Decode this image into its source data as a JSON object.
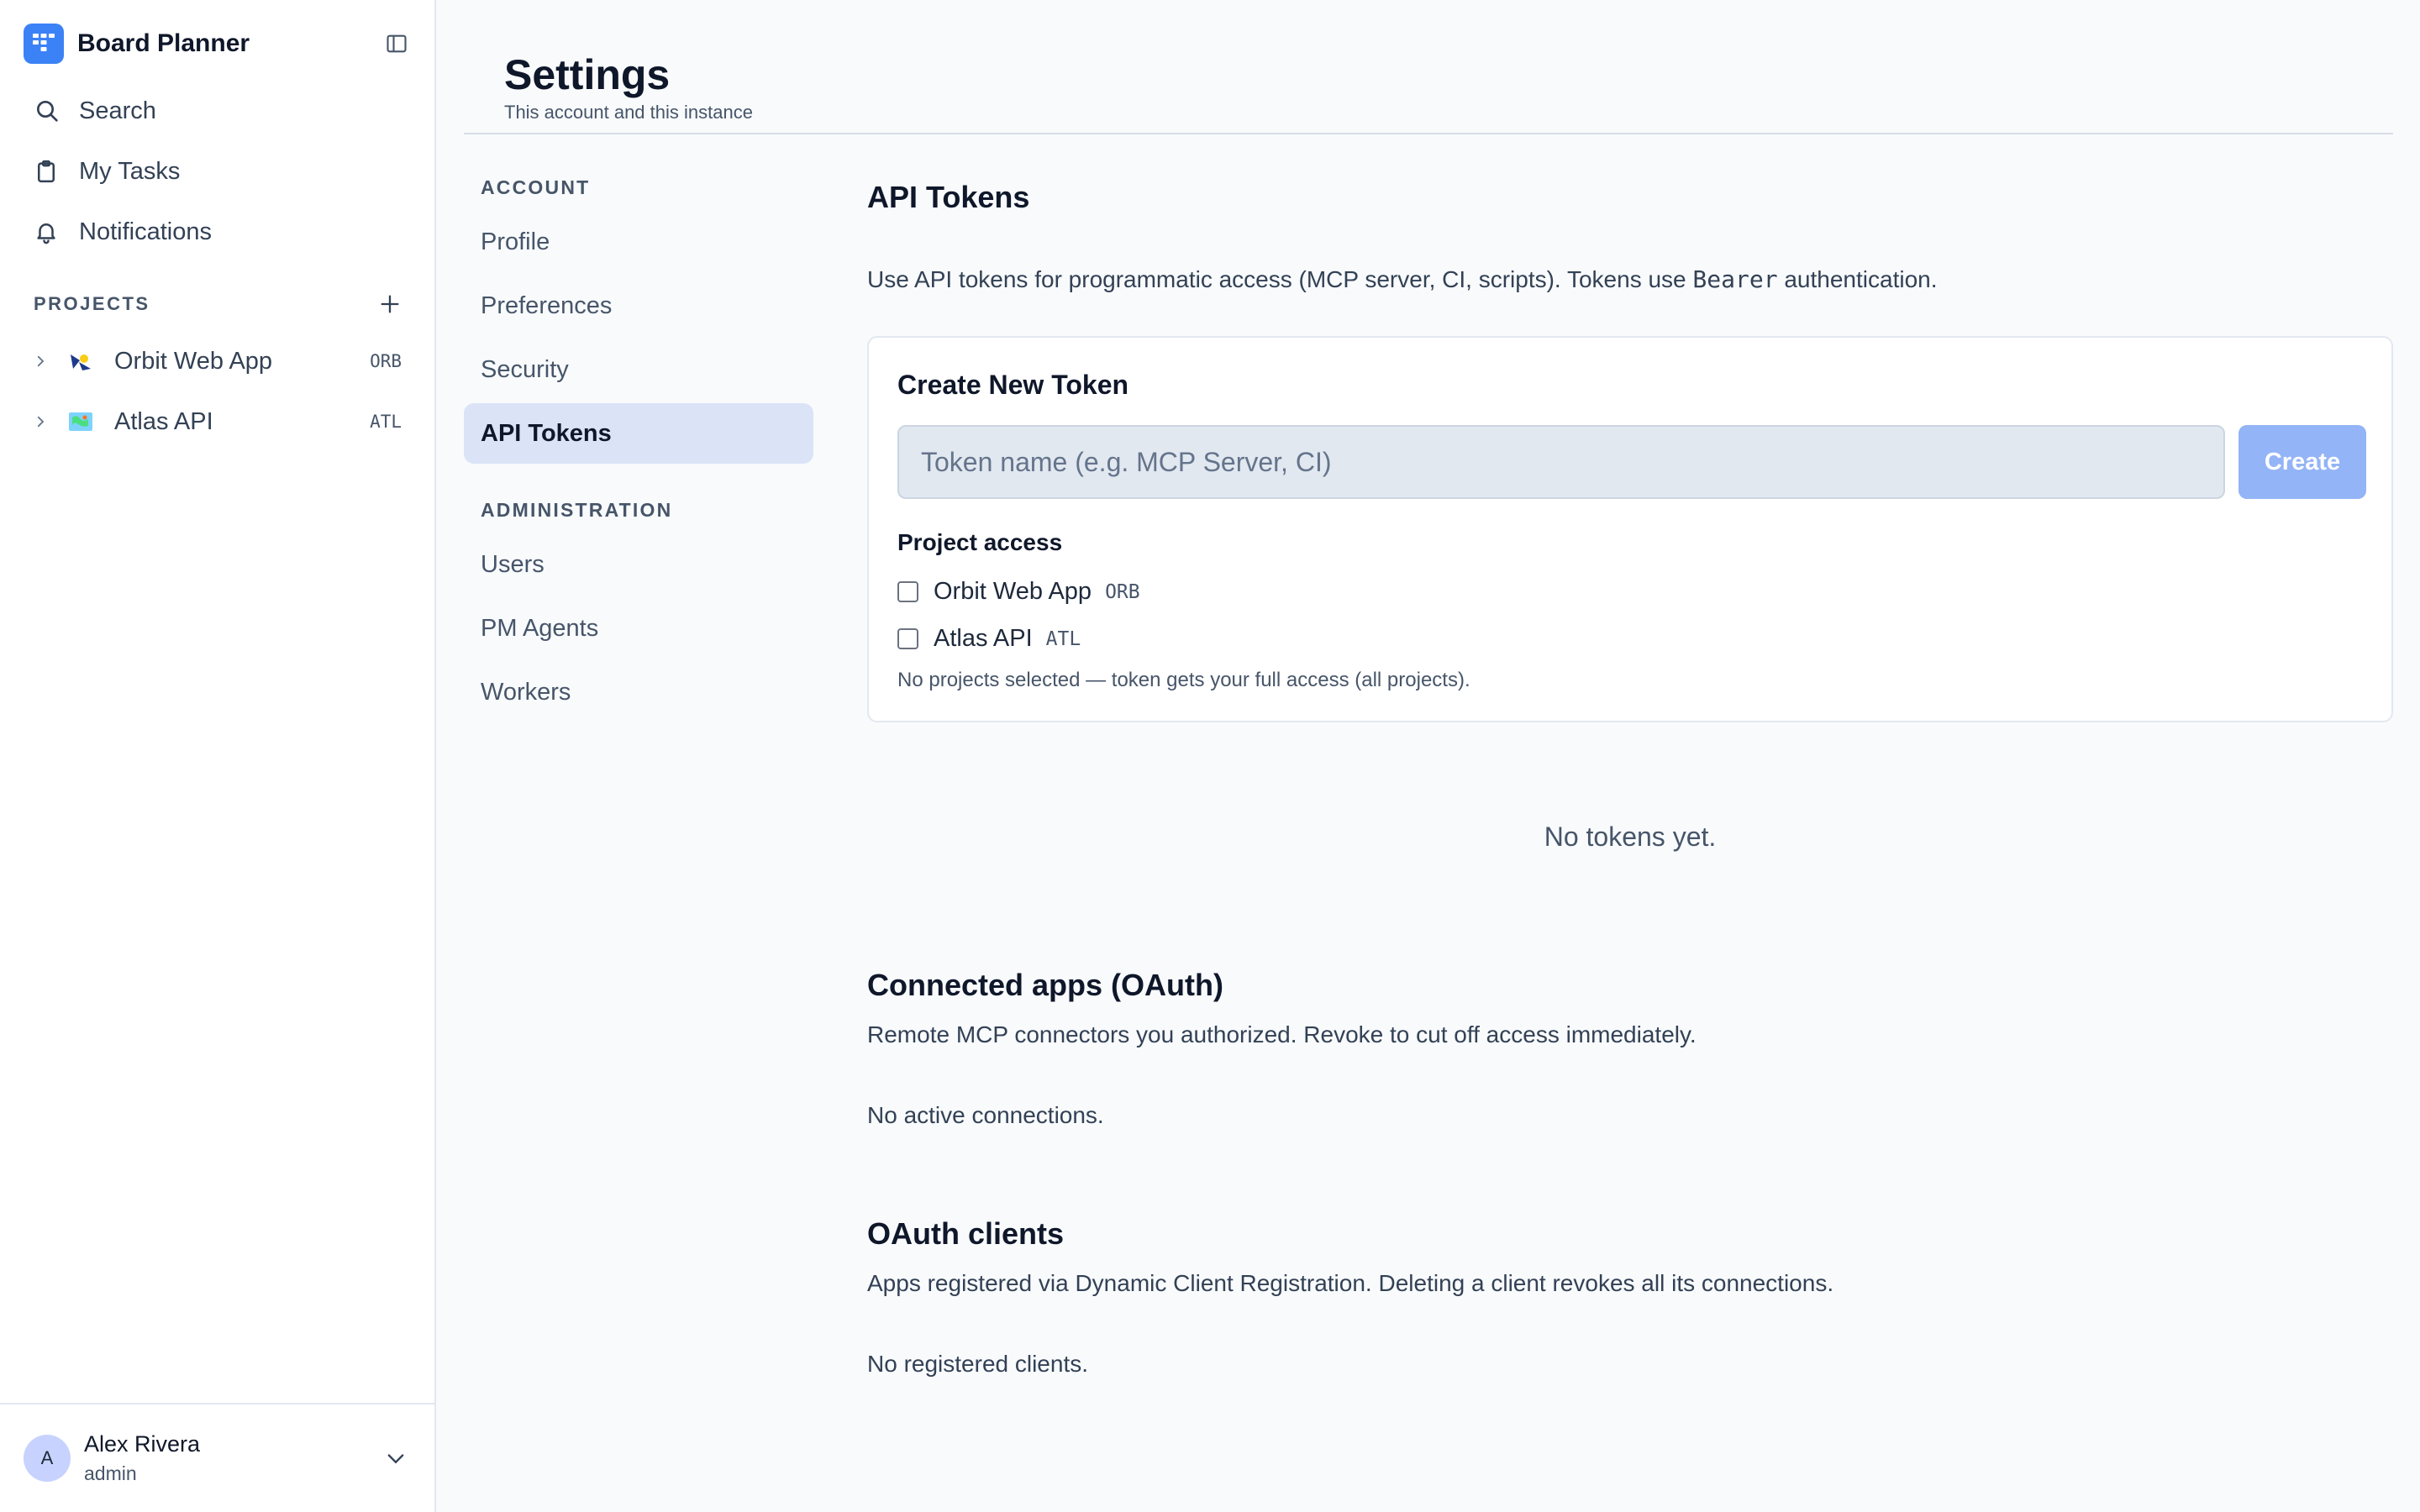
{
  "app": {
    "name": "Board Planner"
  },
  "sidebar": {
    "nav": [
      {
        "label": "Search",
        "icon": "search-icon"
      },
      {
        "label": "My Tasks",
        "icon": "clipboard-icon"
      },
      {
        "label": "Notifications",
        "icon": "bell-icon"
      }
    ],
    "projects_heading": "PROJECTS",
    "projects": [
      {
        "name": "Orbit Web App",
        "key": "ORB",
        "icon": "orbit-emoji-icon"
      },
      {
        "name": "Atlas API",
        "key": "ATL",
        "icon": "map-emoji-icon"
      }
    ],
    "user": {
      "initial": "A",
      "name": "Alex Rivera",
      "role": "admin"
    }
  },
  "page": {
    "title": "Settings",
    "subtitle": "This account and this instance"
  },
  "settings_nav": {
    "account_heading": "ACCOUNT",
    "account_items": [
      "Profile",
      "Preferences",
      "Security",
      "API Tokens"
    ],
    "admin_heading": "ADMINISTRATION",
    "admin_items": [
      "Users",
      "PM Agents",
      "Workers"
    ],
    "active": "API Tokens"
  },
  "api_tokens": {
    "title": "API Tokens",
    "desc_before": "Use API tokens for programmatic access (MCP server, CI, scripts). Tokens use",
    "desc_code": "Bearer",
    "desc_after": "authentication.",
    "create_card": {
      "title": "Create New Token",
      "input_placeholder": "Token name (e.g. MCP Server, CI)",
      "input_value": "",
      "create_label": "Create",
      "project_access_label": "Project access",
      "projects": [
        {
          "name": "Orbit Web App",
          "key": "ORB",
          "checked": false
        },
        {
          "name": "Atlas API",
          "key": "ATL",
          "checked": false
        }
      ],
      "note": "No projects selected — token gets your full access (all projects)."
    },
    "empty": "No tokens yet."
  },
  "connected_apps": {
    "title": "Connected apps (OAuth)",
    "desc": "Remote MCP connectors you authorized. Revoke to cut off access immediately.",
    "empty": "No active connections."
  },
  "oauth_clients": {
    "title": "OAuth clients",
    "desc": "Apps registered via Dynamic Client Registration. Deleting a client revokes all its connections.",
    "empty": "No registered clients."
  },
  "colors": {
    "accent": "#3b82f6",
    "create_button": "#93b4f6",
    "active_nav_bg": "#dbe3f7",
    "page_bg": "#f8fafc"
  }
}
